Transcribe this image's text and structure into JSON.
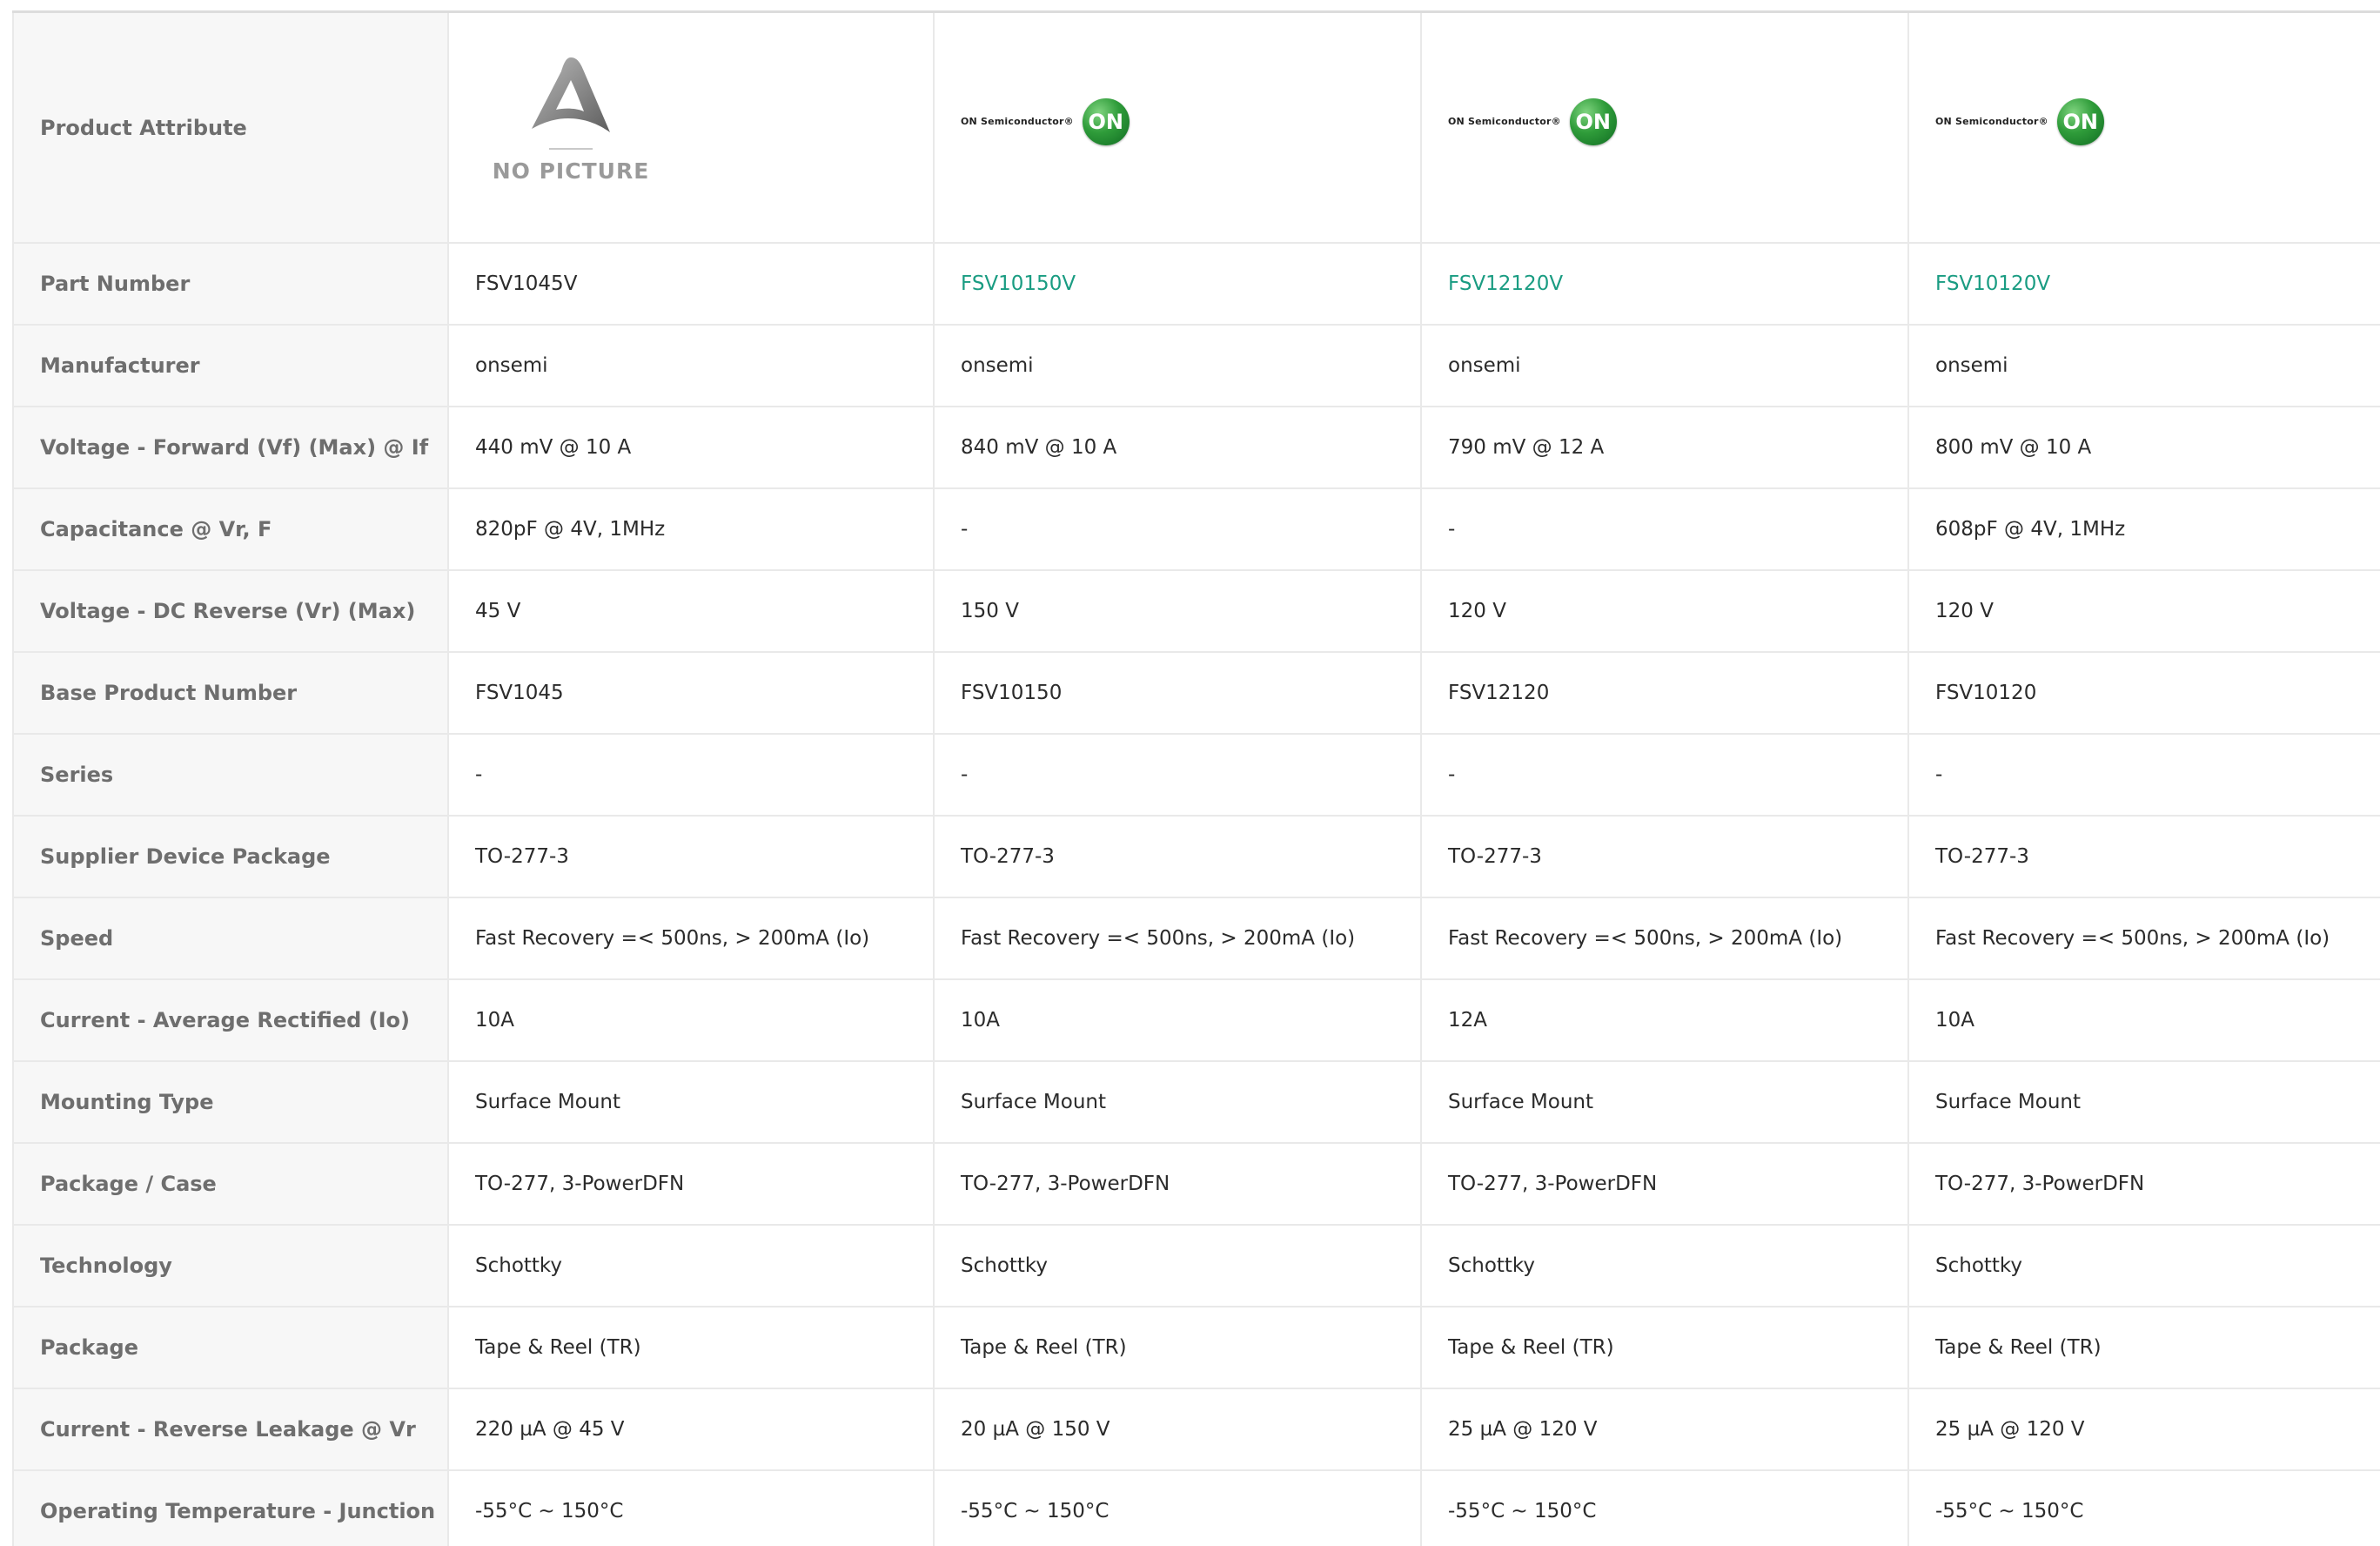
{
  "header_row": {
    "label": "Product Attribute",
    "no_picture_text": "NO PICTURE",
    "logo_wordmark": "ON Semiconductor®",
    "logo_badge": "ON"
  },
  "colors": {
    "link": "#1a9c82",
    "logo_green": "#2f9c3a"
  },
  "rows": [
    {
      "label": "Part Number",
      "values": [
        "FSV1045V",
        "FSV10150V",
        "FSV12120V",
        "FSV10120V"
      ]
    },
    {
      "label": "Manufacturer",
      "values": [
        "onsemi",
        "onsemi",
        "onsemi",
        "onsemi"
      ]
    },
    {
      "label": "Voltage - Forward (Vf) (Max) @ If",
      "values": [
        "440 mV @ 10 A",
        "840 mV @ 10 A",
        "790 mV @ 12 A",
        "800 mV @ 10 A"
      ]
    },
    {
      "label": "Capacitance @ Vr, F",
      "values": [
        "820pF @ 4V, 1MHz",
        "-",
        "-",
        "608pF @ 4V, 1MHz"
      ]
    },
    {
      "label": "Voltage - DC Reverse (Vr) (Max)",
      "values": [
        "45 V",
        "150 V",
        "120 V",
        "120 V"
      ]
    },
    {
      "label": "Base Product Number",
      "values": [
        "FSV1045",
        "FSV10150",
        "FSV12120",
        "FSV10120"
      ]
    },
    {
      "label": "Series",
      "values": [
        "-",
        "-",
        "-",
        "-"
      ]
    },
    {
      "label": "Supplier Device Package",
      "values": [
        "TO-277-3",
        "TO-277-3",
        "TO-277-3",
        "TO-277-3"
      ]
    },
    {
      "label": "Speed",
      "values": [
        "Fast Recovery =< 500ns, > 200mA (Io)",
        "Fast Recovery =< 500ns, > 200mA (Io)",
        "Fast Recovery =< 500ns, > 200mA (Io)",
        "Fast Recovery =< 500ns, > 200mA (Io)"
      ]
    },
    {
      "label": "Current - Average Rectified (Io)",
      "values": [
        "10A",
        "10A",
        "12A",
        "10A"
      ]
    },
    {
      "label": "Mounting Type",
      "values": [
        "Surface Mount",
        "Surface Mount",
        "Surface Mount",
        "Surface Mount"
      ]
    },
    {
      "label": "Package / Case",
      "values": [
        "TO-277, 3-PowerDFN",
        "TO-277, 3-PowerDFN",
        "TO-277, 3-PowerDFN",
        "TO-277, 3-PowerDFN"
      ]
    },
    {
      "label": "Technology",
      "values": [
        "Schottky",
        "Schottky",
        "Schottky",
        "Schottky"
      ]
    },
    {
      "label": "Package",
      "values": [
        "Tape & Reel (TR)",
        "Tape & Reel (TR)",
        "Tape & Reel (TR)",
        "Tape & Reel (TR)"
      ]
    },
    {
      "label": "Current - Reverse Leakage @ Vr",
      "values": [
        "220 µA @ 45 V",
        "20 µA @ 150 V",
        "25 µA @ 120 V",
        "25 µA @ 120 V"
      ]
    },
    {
      "label": "Operating Temperature - Junction",
      "values": [
        "-55°C ~ 150°C",
        "-55°C ~ 150°C",
        "-55°C ~ 150°C",
        "-55°C ~ 150°C"
      ]
    }
  ]
}
